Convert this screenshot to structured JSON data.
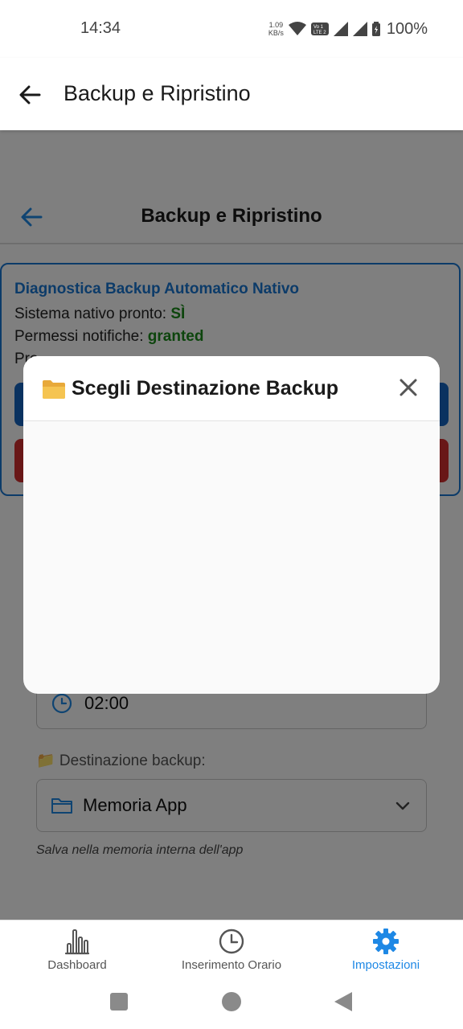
{
  "status_bar": {
    "time": "14:34",
    "speed_value": "1.09",
    "speed_unit": "KB/s",
    "battery": "100%"
  },
  "app_bar": {
    "title": "Backup e Ripristino"
  },
  "page": {
    "title": "Backup e Ripristino",
    "diagnostics": {
      "title": "Diagnostica Backup Automatico Nativo",
      "native_ready_label": "Sistema nativo pronto: ",
      "native_ready_value": "SÌ",
      "notif_perm_label": "Permessi notifiche: ",
      "notif_perm_value": "granted",
      "partial_line": "Pro"
    },
    "backup_time": "02:00",
    "destination": {
      "label": "📁 Destinazione backup:",
      "selected": "Memoria App",
      "hint": "Salva nella memoria interna dell'app"
    }
  },
  "dialog": {
    "title": "Scegli Destinazione Backup"
  },
  "bottom_nav": {
    "items": [
      {
        "label": "Dashboard",
        "icon": "bar-chart-icon"
      },
      {
        "label": "Inserimento Orario",
        "icon": "clock-icon"
      },
      {
        "label": "Impostazioni",
        "icon": "gear-icon",
        "active": true
      }
    ]
  },
  "colors": {
    "accent": "#1e88e5",
    "primary_blue": "#1565c0",
    "danger_red": "#d32f2f",
    "ok_green": "#1b8a1b"
  }
}
